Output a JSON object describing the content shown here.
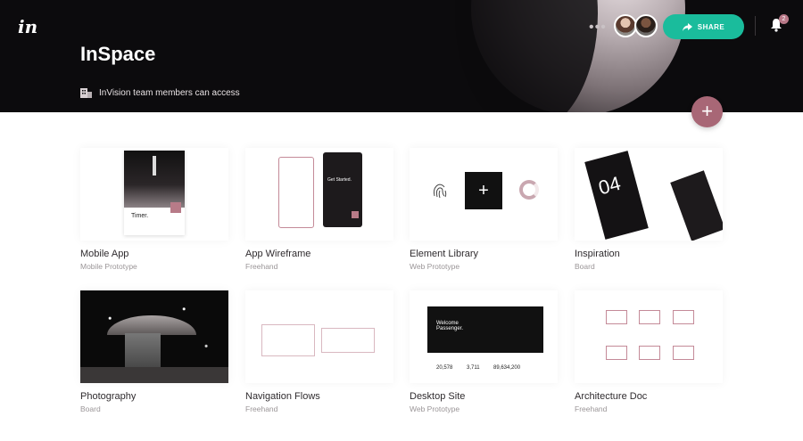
{
  "app": {
    "logo": "in"
  },
  "header": {
    "title": "InSpace",
    "access_text": "InVision team members can access",
    "more_label": "•••",
    "share_label": "SHARE",
    "notification_count": "2"
  },
  "add_button_label": "+",
  "accent_colors": {
    "share": "#1abc9c",
    "brand": "#a86776",
    "header_bg": "#0c0b0d"
  },
  "cards": [
    {
      "name": "Mobile App",
      "type": "Mobile Prototype",
      "thumb_text": "Timer."
    },
    {
      "name": "App Wireframe",
      "type": "Freehand",
      "thumb_text": "Get Started."
    },
    {
      "name": "Element Library",
      "type": "Web Prototype",
      "thumb_text": "+"
    },
    {
      "name": "Inspiration",
      "type": "Board",
      "thumb_text": "04"
    },
    {
      "name": "Photography",
      "type": "Board",
      "thumb_text": ""
    },
    {
      "name": "Navigation Flows",
      "type": "Freehand",
      "thumb_text": ""
    },
    {
      "name": "Desktop Site",
      "type": "Web Prototype",
      "thumb_text": "Welcome Passenger.",
      "stats": [
        "20,578",
        "3,711",
        "89,634,200"
      ]
    },
    {
      "name": "Architecture Doc",
      "type": "Freehand",
      "thumb_text": ""
    }
  ]
}
